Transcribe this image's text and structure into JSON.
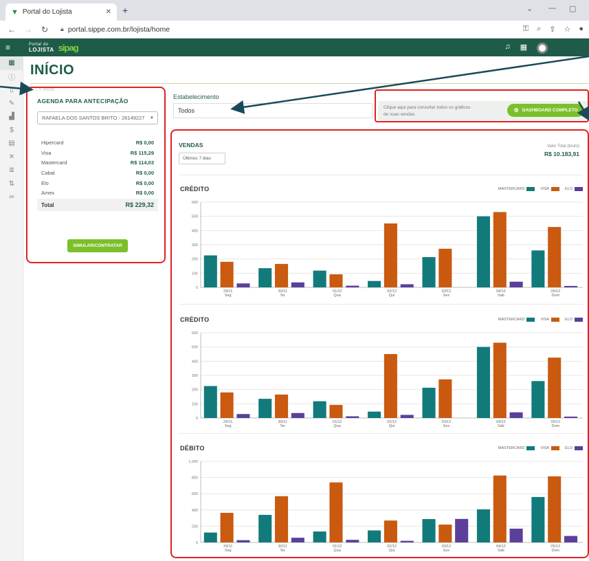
{
  "browser": {
    "tab_title": "Portal do Lojista",
    "tab_close": "✕",
    "new_tab": "+",
    "url": "portal.sippe.com.br/lojista/home"
  },
  "header": {
    "logo_small": "Portal do",
    "logo_lojista": "LOJISTA",
    "logo_brand": "sipag"
  },
  "page": {
    "title": "INÍCIO",
    "breadcrumb": "⌂ > Início"
  },
  "agenda": {
    "title": "AGENDA PARA ANTECIPAÇÃO",
    "select_value": "RAFAELA DOS SANTOS BRITO - 28149227",
    "rows": [
      {
        "label": "Hipercard",
        "value": "R$ 0,00"
      },
      {
        "label": "Visa",
        "value": "R$ 115,29"
      },
      {
        "label": "Mastercard",
        "value": "R$ 114,03"
      },
      {
        "label": "Cabal",
        "value": "R$ 0,00"
      },
      {
        "label": "Elo",
        "value": "R$ 0,00"
      },
      {
        "label": "Amex",
        "value": "R$ 0,00"
      }
    ],
    "total_label": "Total",
    "total_value": "R$ 229,32",
    "button": "SIMULAR/CONTRATAR"
  },
  "estabelecimento": {
    "label": "Estabelecimento",
    "value": "Todos"
  },
  "dashboard": {
    "text": "Clique aqui para consultar todos os gráficos de suas vendas",
    "button": "DASHBOARD COMPLETO"
  },
  "vendas": {
    "title": "VENDAS",
    "period": "Últimos 7 dias",
    "total_label": "Valor Total (bruto)",
    "total_value": "R$ 10.183,91"
  },
  "colors": {
    "mastercard": "#127a7a",
    "visa": "#c95a10",
    "elo": "#5b3f9b",
    "brand": "#1f5b49",
    "accent": "#7bbf2a",
    "annotation": "#e02020"
  },
  "chart_data": [
    {
      "type": "bar",
      "title": "CRÉDITO",
      "categories": [
        "29/11 Seg",
        "30/11 Ter",
        "01/12 Qua",
        "02/12 Qui",
        "03/12 Sex",
        "04/12 Sáb",
        "05/12 Dom"
      ],
      "ylim": [
        0,
        600
      ],
      "yticks": [
        0,
        100,
        200,
        300,
        400,
        500,
        600
      ],
      "series": [
        {
          "name": "MASTERCARD",
          "values": [
            225,
            135,
            118,
            45,
            213,
            500,
            260
          ]
        },
        {
          "name": "VISA",
          "values": [
            180,
            165,
            92,
            450,
            272,
            530,
            425
          ]
        },
        {
          "name": "ELO",
          "values": [
            28,
            35,
            12,
            22,
            0,
            40,
            10
          ]
        }
      ]
    },
    {
      "type": "bar",
      "title": "CRÉDITO",
      "categories": [
        "29/11 Seg",
        "30/11 Ter",
        "01/12 Qua",
        "02/12 Qui",
        "03/12 Sex",
        "04/12 Sáb",
        "05/12 Dom"
      ],
      "ylim": [
        0,
        600
      ],
      "yticks": [
        0,
        100,
        200,
        300,
        400,
        500,
        600
      ],
      "series": [
        {
          "name": "MASTERCARD",
          "values": [
            225,
            135,
            118,
            45,
            213,
            500,
            260
          ]
        },
        {
          "name": "VISA",
          "values": [
            180,
            165,
            92,
            450,
            272,
            530,
            425
          ]
        },
        {
          "name": "ELO",
          "values": [
            28,
            35,
            12,
            22,
            0,
            40,
            10
          ]
        }
      ]
    },
    {
      "type": "bar",
      "title": "DÉBITO",
      "categories": [
        "29/11 Seg",
        "30/11 Ter",
        "01/12 Qua",
        "02/12 Qui",
        "03/12 Sex",
        "04/12 Sáb",
        "05/12 Dom"
      ],
      "ylim": [
        0,
        1000
      ],
      "yticks": [
        0,
        200,
        400,
        600,
        800,
        1000
      ],
      "ytick_labels": [
        "0",
        "200",
        "400",
        "600",
        "800",
        "1,000"
      ],
      "series": [
        {
          "name": "MASTERCARD",
          "values": [
            122,
            340,
            135,
            148,
            288,
            408,
            560
          ]
        },
        {
          "name": "VISA",
          "values": [
            365,
            570,
            740,
            270,
            220,
            825,
            815
          ]
        },
        {
          "name": "ELO",
          "values": [
            28,
            58,
            32,
            20,
            290,
            170,
            80
          ]
        }
      ]
    }
  ]
}
